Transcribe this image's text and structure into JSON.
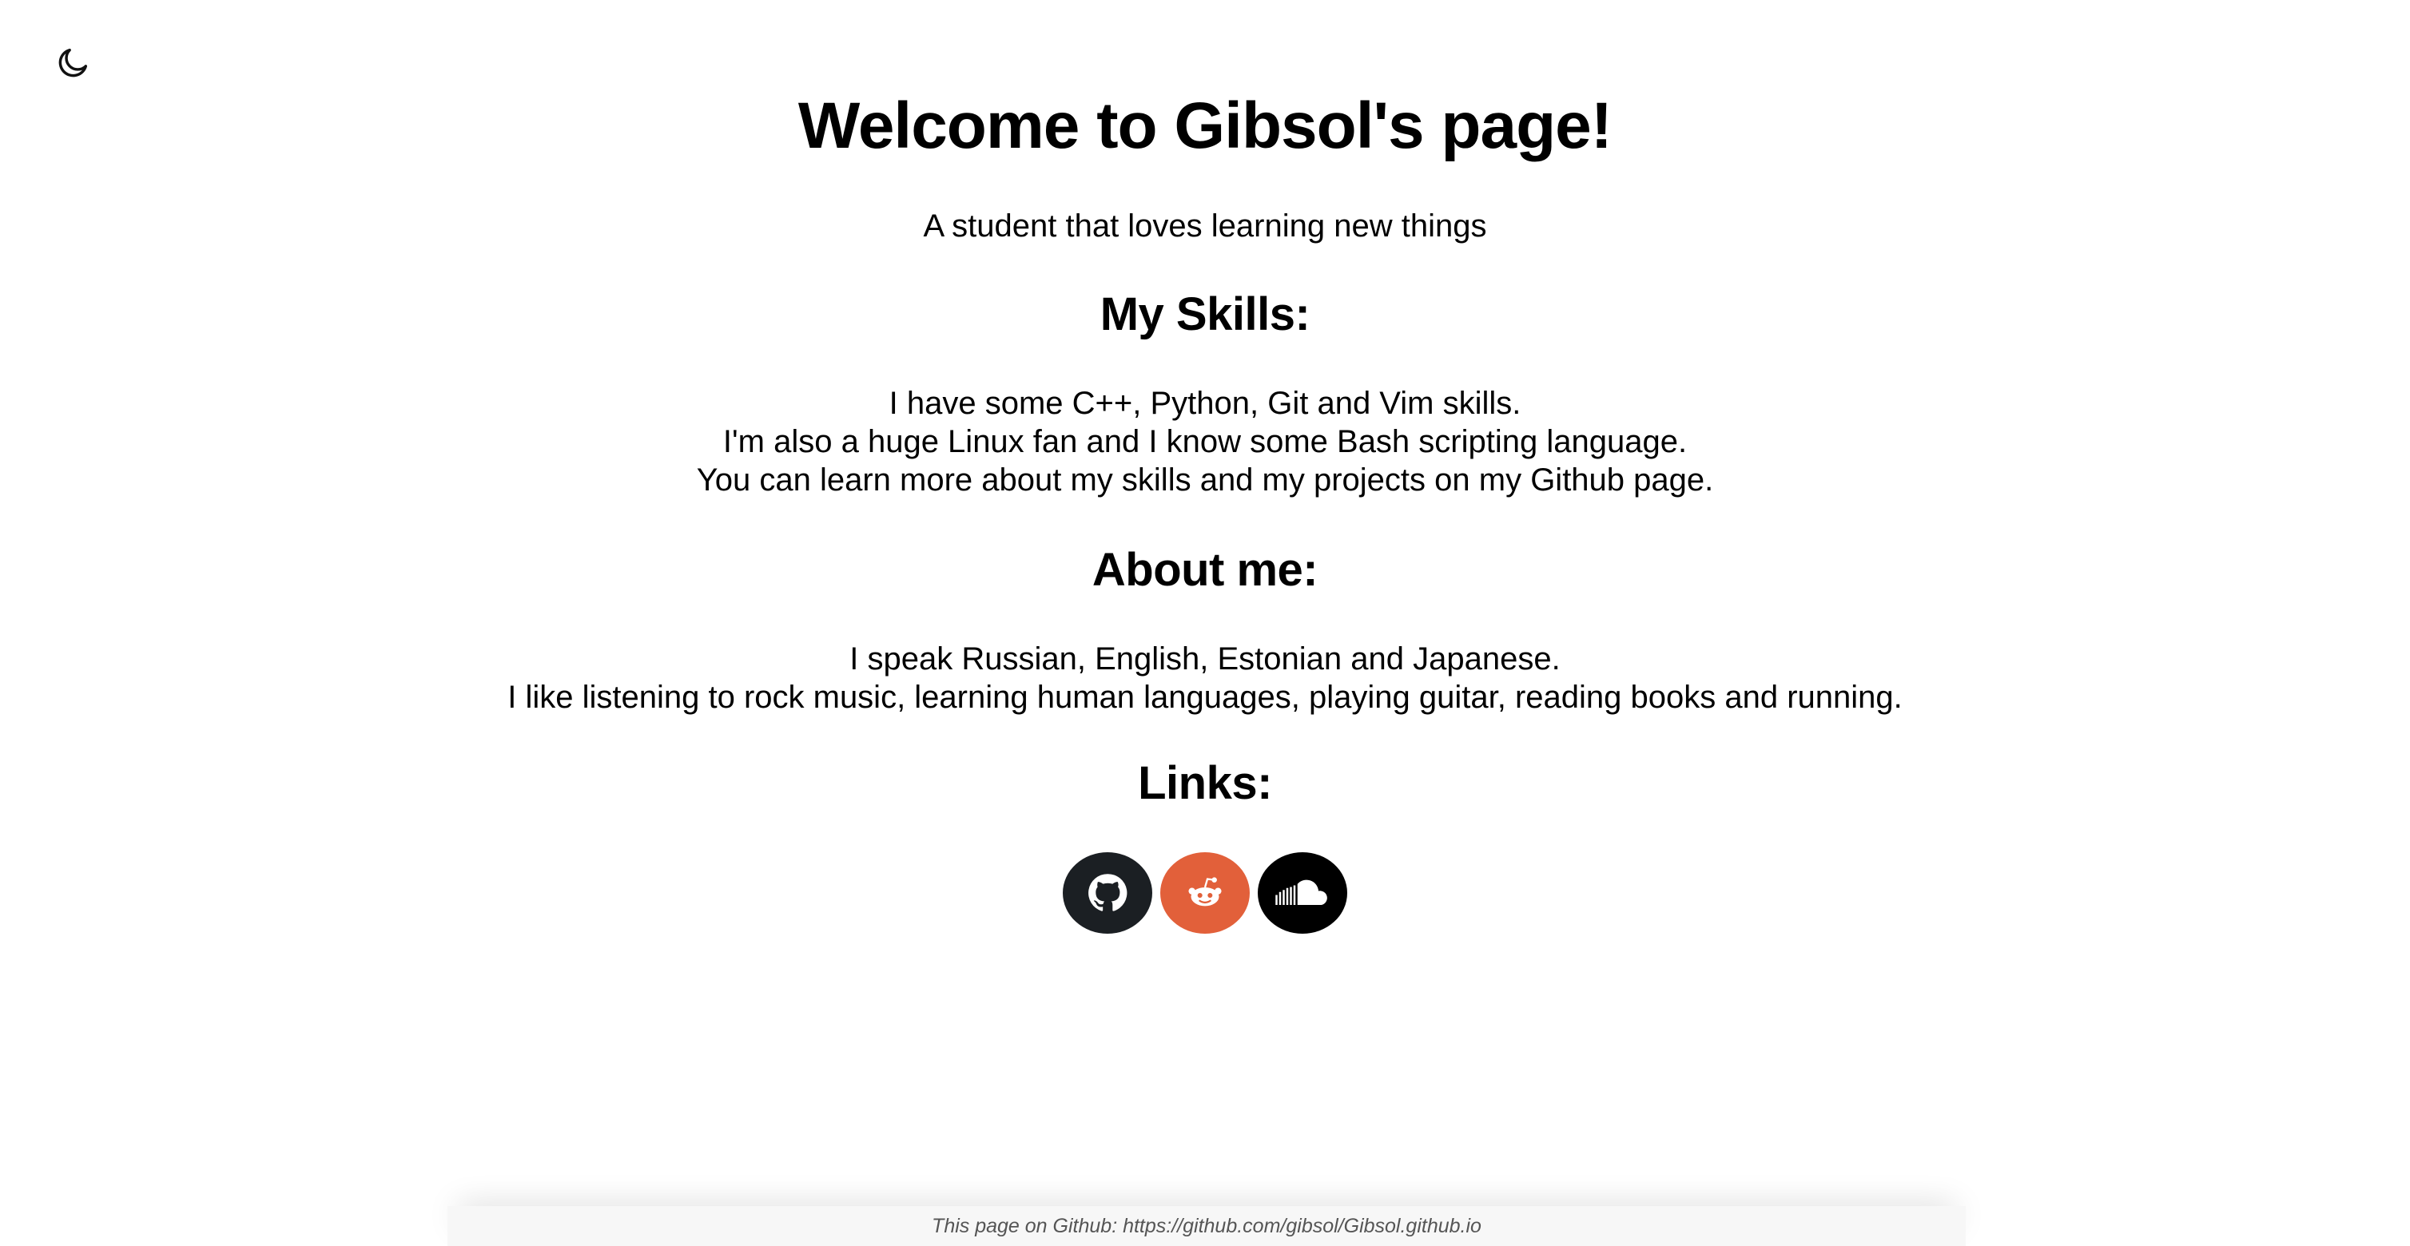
{
  "theme_toggle": {
    "icon": "moon-icon"
  },
  "header": {
    "title": "Welcome to Gibsol's page!",
    "subtitle": "A student that loves learning new things"
  },
  "skills": {
    "heading": "My Skills:",
    "lines": [
      "I have some C++, Python, Git and Vim skills.",
      "I'm also a huge Linux fan and I know some Bash scripting language.",
      "You can learn more about my skills and my projects on my Github page."
    ]
  },
  "about": {
    "heading": "About me:",
    "lines": [
      "I speak Russian, English, Estonian and Japanese.",
      "I like listening to rock music, learning human languages, playing guitar, reading books and running."
    ]
  },
  "links": {
    "heading": "Links:",
    "items": [
      {
        "icon": "github-icon",
        "color": "#1b1f23"
      },
      {
        "icon": "reddit-icon",
        "color": "#e2603a"
      },
      {
        "icon": "soundcloud-icon",
        "color": "#000000"
      }
    ]
  },
  "footer": {
    "text": "This page on Github: https://github.com/gibsol/Gibsol.github.io"
  }
}
